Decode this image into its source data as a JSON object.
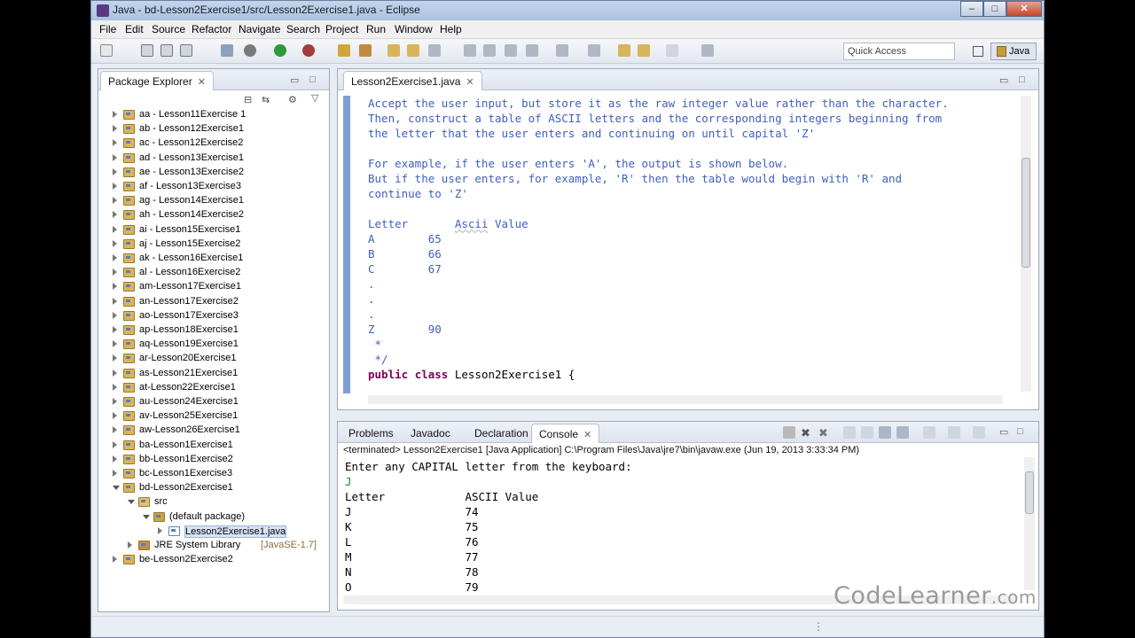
{
  "window": {
    "title": "Java - bd-Lesson2Exercise1/src/Lesson2Exercise1.java - Eclipse",
    "minimize_glyph": "–",
    "maximize_glyph": "□",
    "close_glyph": "✕"
  },
  "menu": [
    "File",
    "Edit",
    "Source",
    "Refactor",
    "Navigate",
    "Search",
    "Project",
    "Run",
    "Window",
    "Help"
  ],
  "toolbar": {
    "quick_access_placeholder": "Quick Access",
    "perspective_label": "Java"
  },
  "package_explorer": {
    "tab_label": "Package Explorer",
    "tree": [
      {
        "label": "aa - Lesson11Exercise 1",
        "level": 0,
        "expanded": false
      },
      {
        "label": "ab - Lesson12Exercise1",
        "level": 0,
        "expanded": false
      },
      {
        "label": "ac - Lesson12Exercise2",
        "level": 0,
        "expanded": false
      },
      {
        "label": "ad - Lesson13Exercise1",
        "level": 0,
        "expanded": false
      },
      {
        "label": "ae - Lesson13Exercise2",
        "level": 0,
        "expanded": false
      },
      {
        "label": "af - Lesson13Exercise3",
        "level": 0,
        "expanded": false
      },
      {
        "label": "ag - Lesson14Exercise1",
        "level": 0,
        "expanded": false
      },
      {
        "label": "ah - Lesson14Exercise2",
        "level": 0,
        "expanded": false
      },
      {
        "label": "ai - Lesson15Exercise1",
        "level": 0,
        "expanded": false
      },
      {
        "label": "aj - Lesson15Exercise2",
        "level": 0,
        "expanded": false
      },
      {
        "label": "ak - Lesson16Exercise1",
        "level": 0,
        "expanded": false
      },
      {
        "label": "al - Lesson16Exercise2",
        "level": 0,
        "expanded": false
      },
      {
        "label": "am-Lesson17Exercise1",
        "level": 0,
        "expanded": false
      },
      {
        "label": "an-Lesson17Exercise2",
        "level": 0,
        "expanded": false
      },
      {
        "label": "ao-Lesson17Exercise3",
        "level": 0,
        "expanded": false
      },
      {
        "label": "ap-Lesson18Exercise1",
        "level": 0,
        "expanded": false
      },
      {
        "label": "aq-Lesson19Exercise1",
        "level": 0,
        "expanded": false
      },
      {
        "label": "ar-Lesson20Exercise1",
        "level": 0,
        "expanded": false
      },
      {
        "label": "as-Lesson21Exercise1",
        "level": 0,
        "expanded": false
      },
      {
        "label": "at-Lesson22Exercise1",
        "level": 0,
        "expanded": false
      },
      {
        "label": "au-Lesson24Exercise1",
        "level": 0,
        "expanded": false
      },
      {
        "label": "av-Lesson25Exercise1",
        "level": 0,
        "expanded": false
      },
      {
        "label": "aw-Lesson26Exercise1",
        "level": 0,
        "expanded": false
      },
      {
        "label": "ba-Lesson1Exercise1",
        "level": 0,
        "expanded": false
      },
      {
        "label": "bb-Lesson1Exercise2",
        "level": 0,
        "expanded": false
      },
      {
        "label": "bc-Lesson1Exercise3",
        "level": 0,
        "expanded": false
      },
      {
        "label": "bd-Lesson2Exercise1",
        "level": 0,
        "expanded": true
      },
      {
        "label": "src",
        "level": 1,
        "expanded": true
      },
      {
        "label": "(default package)",
        "level": 2,
        "expanded": true
      },
      {
        "label": "Lesson2Exercise1.java",
        "level": 3,
        "expanded": false,
        "selected": true
      },
      {
        "label": "JRE System Library",
        "tag": "[JavaSE-1.7]",
        "level": 1,
        "expanded": false
      },
      {
        "label": "be-Lesson2Exercise2",
        "level": 0,
        "expanded": false
      }
    ]
  },
  "editor": {
    "tab_label": "Lesson2Exercise1.java",
    "lines": [
      "Accept the user input, but store it as the raw integer value rather than the character.",
      "Then, construct a table of ASCII letters and the corresponding integers beginning from",
      "the letter that the user enters and continuing on until capital 'Z'",
      "",
      "For example, if the user enters 'A', the output is shown below.",
      "But if the user enters, for example, 'R' then the table would begin with 'R' and",
      "continue to 'Z'",
      "",
      "Letter       Ascii Value",
      "A        65",
      "B        66",
      "C        67",
      ".",
      ".",
      ".",
      "Z        90",
      " *",
      " */"
    ],
    "class_decl": {
      "kw1": "public",
      "kw2": "class",
      "name": "Lesson2Exercise1 {"
    }
  },
  "bottom_tabs": [
    "Problems",
    "Javadoc",
    "Declaration",
    "Console"
  ],
  "console": {
    "status": "<terminated> Lesson2Exercise1 [Java Application] C:\\Program Files\\Java\\jre7\\bin\\javaw.exe (Jun 19, 2013 3:33:34 PM)",
    "lines": [
      {
        "text": "Enter any CAPITAL letter from the keyboard:",
        "input": false
      },
      {
        "text": "J",
        "input": true
      },
      {
        "text": "Letter            ASCII Value",
        "input": false
      },
      {
        "text": "J                 74",
        "input": false
      },
      {
        "text": "K                 75",
        "input": false
      },
      {
        "text": "L                 76",
        "input": false
      },
      {
        "text": "M                 77",
        "input": false
      },
      {
        "text": "N                 78",
        "input": false
      },
      {
        "text": "O                 79",
        "input": false
      }
    ]
  },
  "watermark": {
    "main": "CodeLearner",
    "suffix": ".com"
  },
  "colors": {
    "keyword": "#7f0055",
    "comment": "#3f5fbf",
    "console_input": "#0a8f22"
  }
}
